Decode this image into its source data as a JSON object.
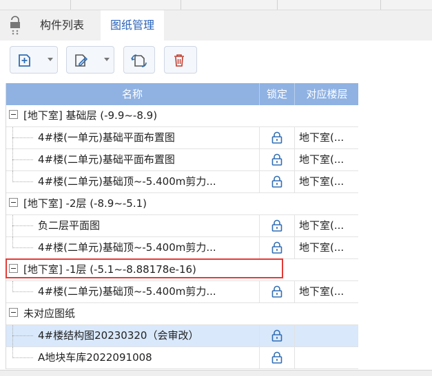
{
  "tabs": [
    {
      "label": "构件列表",
      "active": false
    },
    {
      "label": "图纸管理",
      "active": true
    }
  ],
  "toolbar": {
    "buttons": [
      {
        "icon": "add-drawing-icon",
        "dropdown": true
      },
      {
        "icon": "edit-drawing-icon",
        "dropdown": true
      },
      {
        "icon": "rotate-drawing-icon",
        "dropdown": false
      },
      {
        "icon": "delete-icon",
        "dropdown": false
      }
    ]
  },
  "table": {
    "headers": [
      "名称",
      "锁定",
      "对应楼层"
    ],
    "rows": [
      {
        "type": "group",
        "name": "[地下室] 基础层 (-9.9~-8.9)",
        "floor": ""
      },
      {
        "type": "child",
        "name": "4#楼(一单元)基础平面布置图",
        "floor": "地下室(..."
      },
      {
        "type": "child",
        "name": "4#楼(二单元)基础平面布置图",
        "floor": "地下室(..."
      },
      {
        "type": "child",
        "name": "4#楼(二单元)基础顶~-5.400m剪力...",
        "floor": "地下室(..."
      },
      {
        "type": "group",
        "name": "[地下室] -2层 (-8.9~-5.1)",
        "floor": ""
      },
      {
        "type": "child",
        "name": "负二层平面图",
        "floor": "地下室(..."
      },
      {
        "type": "child",
        "name": "4#楼(二单元)基础顶~-5.400m剪力...",
        "floor": "地下室(..."
      },
      {
        "type": "group",
        "name": "[地下室] -1层 (-5.1~-8.88178e-16)",
        "floor": ""
      },
      {
        "type": "child",
        "name": "4#楼(二单元)基础顶~-5.400m剪力...",
        "floor": "地下室(..."
      },
      {
        "type": "group",
        "name": "未对应图纸",
        "floor": ""
      },
      {
        "type": "child",
        "name": "4#楼结构图20230320（会审改）",
        "floor": "",
        "selected": true
      },
      {
        "type": "child",
        "name": "A地块车库2022091008",
        "floor": ""
      }
    ]
  },
  "colors": {
    "header_bg": "#8fb2e3",
    "selected_row": "#d9e8fb",
    "highlight": "#e53935",
    "active_tab_text": "#2a63b8"
  }
}
